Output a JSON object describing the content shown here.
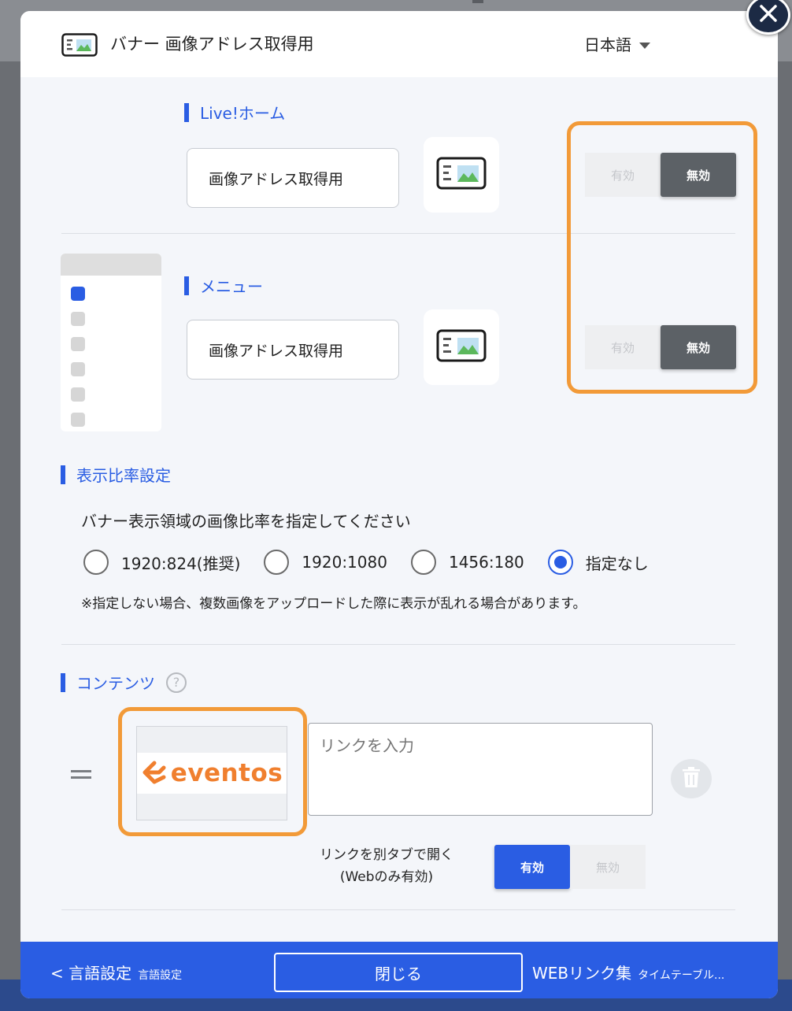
{
  "header": {
    "title": "バナー 画像アドレス取得用",
    "language": "日本語"
  },
  "sections": {
    "live_home": {
      "label": "Live!ホーム",
      "text_value": "画像アドレス取得用",
      "toggle": {
        "enabled_label": "有効",
        "disabled_label": "無効",
        "state": "無効"
      }
    },
    "menu": {
      "label": "メニュー",
      "text_value": "画像アドレス取得用",
      "toggle": {
        "enabled_label": "有効",
        "disabled_label": "無効",
        "state": "無効"
      }
    },
    "ratio": {
      "label": "表示比率設定",
      "description": "バナー表示領域の画像比率を指定してください",
      "options": [
        "1920:824(推奨)",
        "1920:1080",
        "1456:180",
        "指定なし"
      ],
      "selected": "指定なし",
      "note": "※指定しない場合、複数画像をアップロードした際に表示が乱れる場合があります。"
    },
    "contents": {
      "label": "コンテンツ",
      "help_icon": "?",
      "logo_text": "eventos",
      "link_placeholder": "リンクを入力",
      "new_tab_label_line1": "リンクを別タブで開く",
      "new_tab_label_line2": "(Webのみ有効)",
      "toggle": {
        "enabled_label": "有効",
        "disabled_label": "無効",
        "state": "有効"
      }
    }
  },
  "footer": {
    "prev_label": "< 言語設定",
    "prev_sub": "言語設定",
    "close_label": "閉じる",
    "next_label": "WEBリンク集",
    "next_sub": "タイムテーブル..."
  },
  "colors": {
    "accent": "#2a5de3",
    "highlight": "#f29a38",
    "logo": "#f07f2e"
  }
}
